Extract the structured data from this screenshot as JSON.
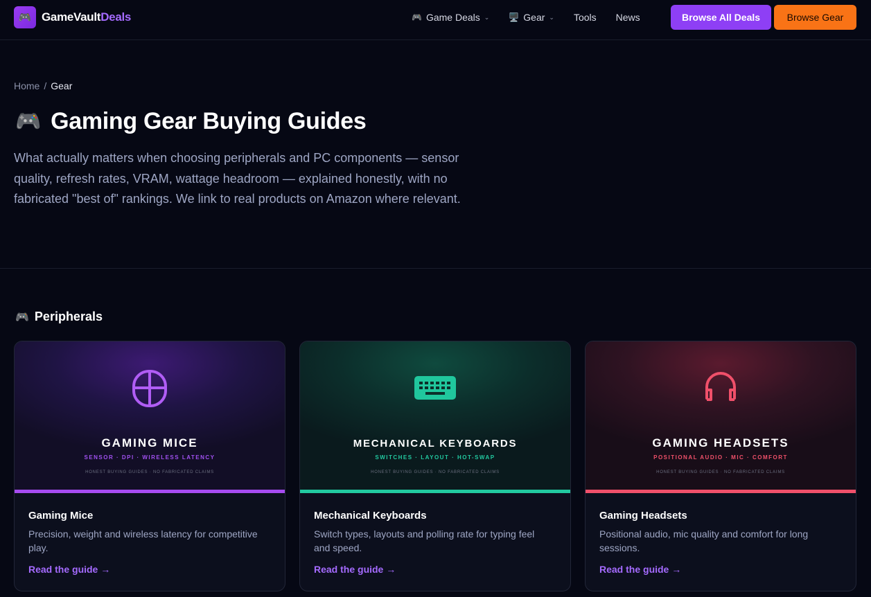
{
  "brand": {
    "logo_emoji": "🎮",
    "name_a": "GameVault",
    "name_b": "Deals"
  },
  "nav": {
    "game_deals": {
      "emoji": "🎮",
      "label": "Game Deals",
      "chevron": "⌄"
    },
    "gear": {
      "emoji": "🖥️",
      "label": "Gear",
      "chevron": "⌄"
    },
    "tools": "Tools",
    "news": "News",
    "browse_all": "Browse All Deals",
    "browse_gear": "Browse Gear"
  },
  "breadcrumb": {
    "home": "Home",
    "sep": "/",
    "current": "Gear"
  },
  "hero": {
    "emoji": "🎮",
    "title": "Gaming Gear Buying Guides",
    "lead": "What actually matters when choosing peripherals and PC components — sensor quality, refresh rates, VRAM, wattage headroom — explained honestly, with no fabricated \"best of\" rankings. We link to real products on Amazon where relevant."
  },
  "section": {
    "emoji": "🎮",
    "title": "Peripherals"
  },
  "cards": [
    {
      "icon": "mouse-icon",
      "accent": "#a64bf0",
      "banner_title": "GAMING MICE",
      "banner_sub": "SENSOR · DPI · WIRELESS LATENCY",
      "banner_foot": "HONEST BUYING GUIDES · NO FABRICATED CLAIMS",
      "title": "Gaming Mice",
      "desc": "Precision, weight and wireless latency for competitive play.",
      "link": "Read the guide →"
    },
    {
      "icon": "keyboard-icon",
      "accent": "#22c9a0",
      "banner_title": "MECHANICAL KEYBOARDS",
      "banner_sub": "SWITCHES · LAYOUT · HOT-SWAP",
      "banner_foot": "HONEST BUYING GUIDES · NO FABRICATED CLAIMS",
      "title": "Mechanical Keyboards",
      "desc": "Switch types, layouts and polling rate for typing feel and speed.",
      "link": "Read the guide →"
    },
    {
      "icon": "headset-icon",
      "accent": "#f0506a",
      "banner_title": "GAMING HEADSETS",
      "banner_sub": "POSITIONAL AUDIO · MIC · COMFORT",
      "banner_foot": "HONEST BUYING GUIDES · NO FABRICATED CLAIMS",
      "title": "Gaming Headsets",
      "desc": "Positional audio, mic quality and comfort for long sessions.",
      "link": "Read the guide →"
    }
  ]
}
